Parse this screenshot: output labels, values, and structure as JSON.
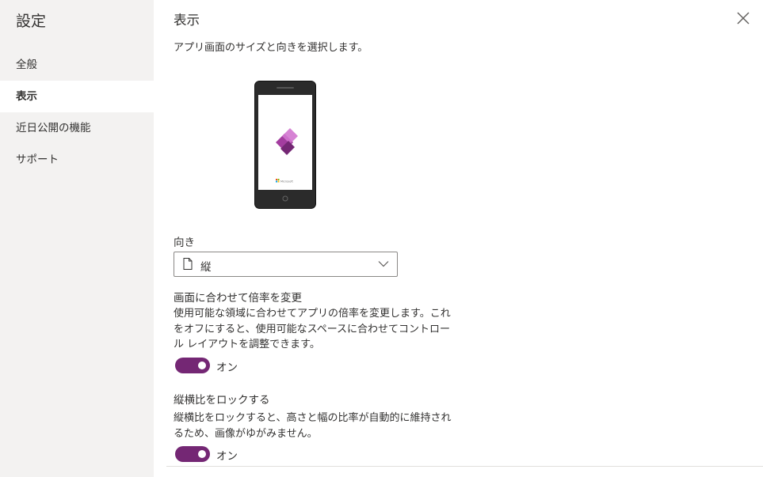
{
  "sidebar": {
    "title": "設定",
    "items": [
      {
        "label": "全般"
      },
      {
        "label": "表示"
      },
      {
        "label": "近日公開の機能"
      },
      {
        "label": "サポート"
      }
    ]
  },
  "main": {
    "title": "表示",
    "description": "アプリ画面のサイズと向きを選択します。",
    "preview": {
      "brand_text": "Microsoft"
    },
    "orientation": {
      "label": "向き",
      "value": "縦"
    },
    "scale_to_fit": {
      "title": "画面に合わせて倍率を変更",
      "description_lines": [
        "使用可能な領域に合わせてアプリの倍率を変更します。これ",
        "をオフにすると、使用可能なスペースに合わせてコントロー",
        "ル レイアウトを調整できます。"
      ],
      "state_label": "オン"
    },
    "lock_aspect": {
      "title": "縦横比をロックする",
      "description_lines": [
        "縦横比をロックすると、高さと幅の比率が自動的に維持され",
        "るため、画像がゆがみません。"
      ],
      "state_label": "オン"
    }
  },
  "colors": {
    "accent": "#742774",
    "sidebar_bg": "#f3f2f1"
  }
}
